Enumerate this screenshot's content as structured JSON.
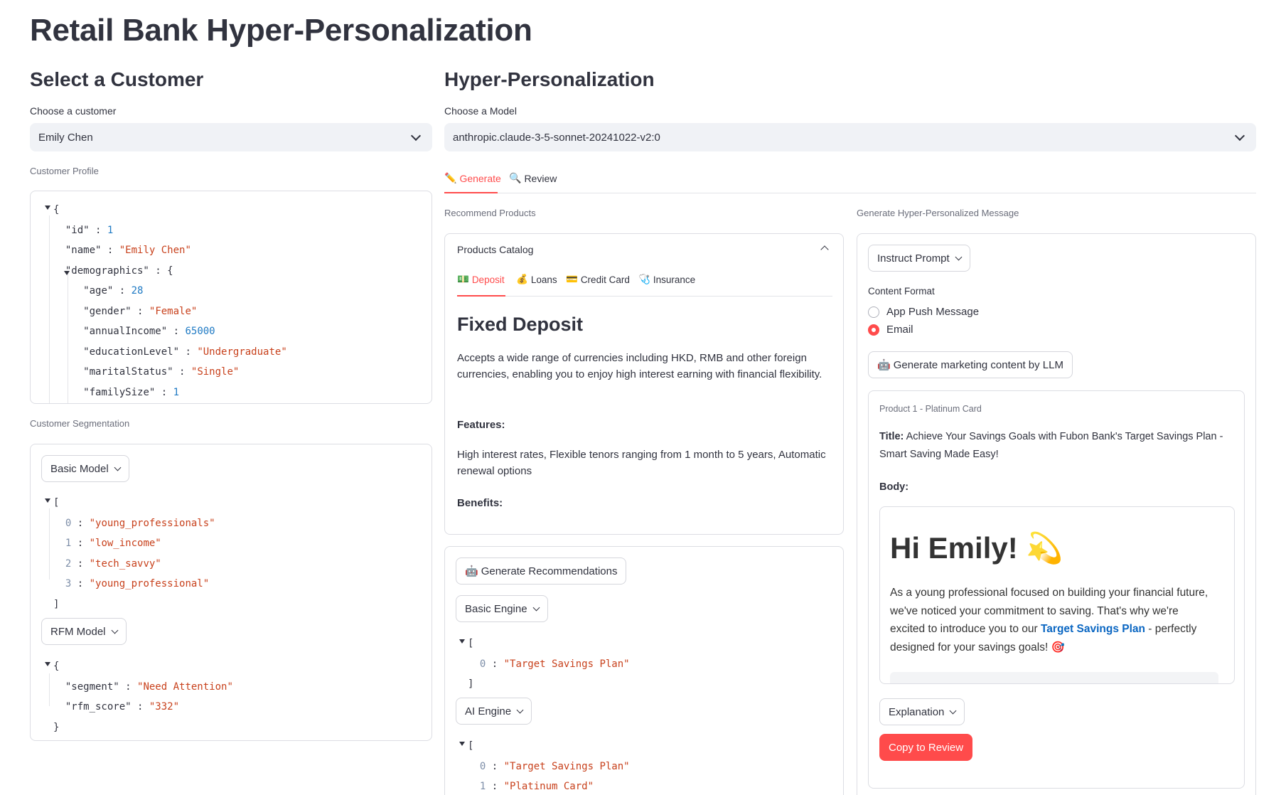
{
  "app": {
    "title": "Retail Bank Hyper-Personalization"
  },
  "left": {
    "heading": "Select a Customer",
    "customer_label": "Choose a customer",
    "customer_value": "Emily Chen",
    "profile_label": "Customer Profile",
    "profile": {
      "open": "{",
      "id_key": "\"id\"",
      "id_val": "1",
      "name_key": "\"name\"",
      "name_val": "\"Emily Chen\"",
      "demo_key": "\"demographics\"",
      "demo_open": "{",
      "age_key": "\"age\"",
      "age_val": "28",
      "gender_key": "\"gender\"",
      "gender_val": "\"Female\"",
      "income_key": "\"annualIncome\"",
      "income_val": "65000",
      "edu_key": "\"educationLevel\"",
      "edu_val": "\"Undergraduate\"",
      "marital_key": "\"maritalStatus\"",
      "marital_val": "\"Single\"",
      "family_key": "\"familySize\"",
      "family_val": "1"
    },
    "segmentation_label": "Customer Segmentation",
    "basic_model_label": "Basic Model",
    "segments": [
      "\"young_professionals\"",
      "\"low_income\"",
      "\"tech_savvy\"",
      "\"young_professional\""
    ],
    "rfm_model_label": "RFM Model",
    "rfm": {
      "segment_key": "\"segment\"",
      "segment_val": "\"Need Attention\"",
      "score_key": "\"rfm_score\"",
      "score_val": "\"332\""
    }
  },
  "right": {
    "heading": "Hyper-Personalization",
    "model_label": "Choose a Model",
    "model_value": "anthropic.claude-3-5-sonnet-20241022-v2:0",
    "tabs": {
      "generate": "Generate",
      "review": "Review"
    },
    "recommend_label": "Recommend Products",
    "catalog": {
      "title": "Products Catalog",
      "tabs": [
        "Deposit",
        "Loans",
        "Credit Card",
        "Insurance"
      ],
      "product_title": "Fixed Deposit",
      "description": "Accepts a wide range of currencies including HKD, RMB and other foreign currencies, enabling you to enjoy high interest earning with financial flexibility.",
      "features_label": "Features:",
      "features": "High interest rates, Flexible tenors ranging from 1 month to 5 years, Automatic renewal options",
      "benefits_label": "Benefits:"
    },
    "reco": {
      "generate_button": "Generate Recommendations",
      "basic_engine_label": "Basic Engine",
      "basic_results": [
        "\"Target Savings Plan\""
      ],
      "ai_engine_label": "AI Engine",
      "ai_results": [
        "\"Target Savings Plan\"",
        "\"Platinum Card\""
      ]
    },
    "message": {
      "label": "Generate Hyper-Personalized Message",
      "instruct_button": "Instruct Prompt",
      "format_label": "Content Format",
      "formats": [
        "App Push Message",
        "Email"
      ],
      "selected_format": "Email",
      "generate_button": "Generate marketing content by LLM",
      "product_caption": "Product 1 - Platinum Card",
      "title_label": "Title:",
      "title_text": "Achieve Your Savings Goals with Fubon Bank's Target Savings Plan - Smart Saving Made Easy!",
      "body_label": "Body:",
      "email_greeting": "Hi Emily! 💫",
      "email_p1": "As a young professional focused on building your financial future, we've noticed your commitment to saving. That's why we're excited to introduce you to our ",
      "email_link": "Target Savings Plan",
      "email_p2": " - perfectly designed for your savings goals! 🎯",
      "explanation_button": "Explanation",
      "copy_button": "Copy to Review"
    }
  },
  "colors": {
    "accent": "#ff4b4b",
    "string": "#c8411c",
    "number": "#1f7ac4",
    "link": "#0a66c2"
  }
}
